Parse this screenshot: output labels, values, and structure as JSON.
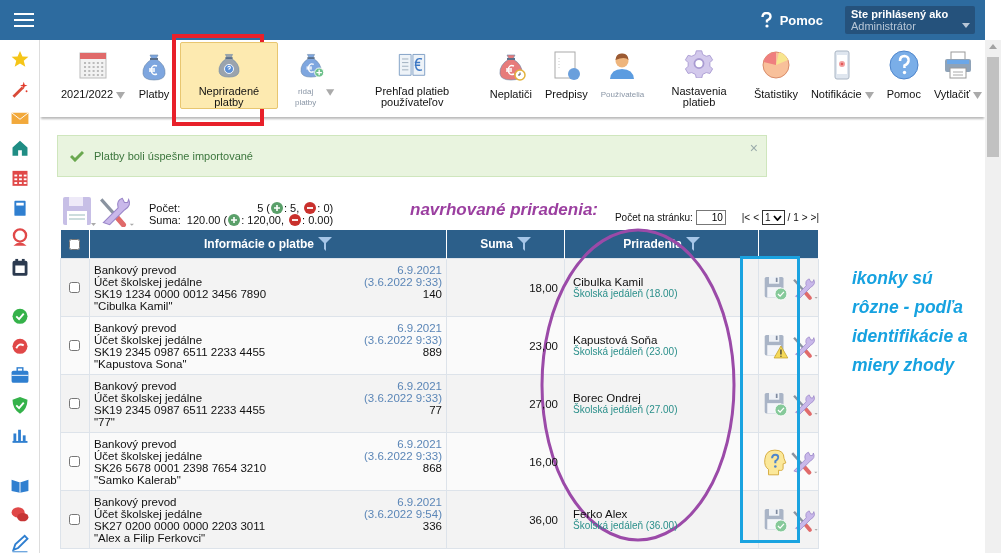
{
  "header": {
    "help": "Pomoc",
    "user_caption": "Ste prihlásený ako",
    "user_value": "Administrátor"
  },
  "toolbar": [
    {
      "kind": "calendar",
      "label": "2021/2022",
      "dropdown": true,
      "selected": false,
      "disabled": false
    },
    {
      "kind": "bag",
      "label": "Platby",
      "dropdown": false,
      "selected": false,
      "disabled": false
    },
    {
      "kind": "bag-question",
      "label": "Nepriradené platby",
      "dropdown": false,
      "selected": true,
      "disabled": false
    },
    {
      "kind": "bag-plus",
      "label": "ridaj platby",
      "dropdown": true,
      "selected": false,
      "disabled": true
    },
    {
      "kind": "book",
      "label": "Prehľad platieb používateľov",
      "dropdown": false,
      "selected": false,
      "disabled": false
    },
    {
      "kind": "bag-clock",
      "label": "Neplatiči",
      "dropdown": false,
      "selected": false,
      "disabled": false
    },
    {
      "kind": "document",
      "label": "Predpisy",
      "dropdown": false,
      "selected": false,
      "disabled": false
    },
    {
      "kind": "person",
      "label": "Používatelia",
      "dropdown": false,
      "selected": false,
      "disabled": true
    },
    {
      "kind": "gear",
      "label": "Nastavenia platieb",
      "dropdown": false,
      "selected": false,
      "disabled": false
    },
    {
      "kind": "pie",
      "label": "Štatistiky",
      "dropdown": false,
      "selected": false,
      "disabled": false
    },
    {
      "kind": "phone",
      "label": "Notifikácie",
      "dropdown": true,
      "selected": false,
      "disabled": false
    },
    {
      "kind": "help",
      "label": "Pomoc",
      "dropdown": false,
      "selected": false,
      "disabled": false
    },
    {
      "kind": "printer",
      "label": "Vytlačiť",
      "dropdown": true,
      "selected": false,
      "disabled": false
    }
  ],
  "alert": {
    "text": "Platby boli úspešne importované",
    "close": "×"
  },
  "summary": {
    "count_label": "Počet:",
    "count_total": "5 (",
    "count_plus": ": 5,",
    "count_minus": ": 0)",
    "sum_label": "Suma:",
    "sum_total": "120.00 (",
    "sum_plus": ": 120,00,",
    "sum_minus": ": 0.00)"
  },
  "pagination": {
    "per_page_label": "Počet na stránku:",
    "per_page": "10",
    "first": "|<",
    "prev": "<",
    "page": "1",
    "of": "/ 1",
    "next": ">",
    "last": ">|"
  },
  "table": {
    "all_checked": false,
    "columns": [
      "Informácie o platbe",
      "Suma",
      "Priradenia"
    ],
    "rows": [
      {
        "checked": false,
        "type": "Bankový prevod",
        "account": "Účet školskej jedálne",
        "iban": "SK19 1234 0000 0012 3456 7890",
        "name": "\"Cibulka Kamil\"",
        "date": "6.9.2021",
        "imported": "(3.6.2022 9:33)",
        "number": "140",
        "amount": "18,00",
        "assignee": "Cibulka Kamil",
        "assignment": "Školská jedáleň (18.00)",
        "kind": "ok"
      },
      {
        "checked": false,
        "type": "Bankový prevod",
        "account": "Účet školskej jedálne",
        "iban": "SK19 2345 0987 6511 2233 4455",
        "name": "\"Kapustova Sona\"",
        "date": "6.9.2021",
        "imported": "(3.6.2022 9:33)",
        "number": "889",
        "amount": "23,00",
        "assignee": "Kapustová Soňa",
        "assignment": "Školská jedáleň  (23.00)",
        "kind": "warning"
      },
      {
        "checked": false,
        "type": "Bankový prevod",
        "account": "Účet školskej jedálne",
        "iban": "SK19 2345 0987 6511 2233 4455",
        "name": "\"77\"",
        "date": "6.9.2021",
        "imported": "(3.6.2022 9:33)",
        "number": "77",
        "amount": "27,00",
        "assignee": "Borec Ondrej",
        "assignment": "Školská jedáleň (27.00)",
        "kind": "ok"
      },
      {
        "checked": false,
        "type": "Bankový prevod",
        "account": "Účet školskej jedálne",
        "iban": "SK26 5678 0001 2398 7654 3210",
        "name": "\"Samko Kalerab\"",
        "date": "6.9.2021",
        "imported": "(3.6.2022 9:33)",
        "number": "868",
        "amount": "16,00",
        "kind": "unknown"
      },
      {
        "checked": false,
        "type": "Bankový prevod",
        "account": "Účet školskej jedálne",
        "iban": "SK27 0200 0000 0000 2203 3011",
        "name": "\"Alex a Filip Ferkovci\"",
        "date": "6.9.2021",
        "imported": "(3.6.2022 9:54)",
        "number": "336",
        "amount": "36,00",
        "assignee": "Ferko Alex",
        "assignment": "Školská jedáleň (36.00)",
        "kind": "ok"
      }
    ]
  },
  "annotations": {
    "label": "navrhované priradenia:",
    "note": "ikonky sú rôzne - podľa identifikácie a miery zhody"
  }
}
